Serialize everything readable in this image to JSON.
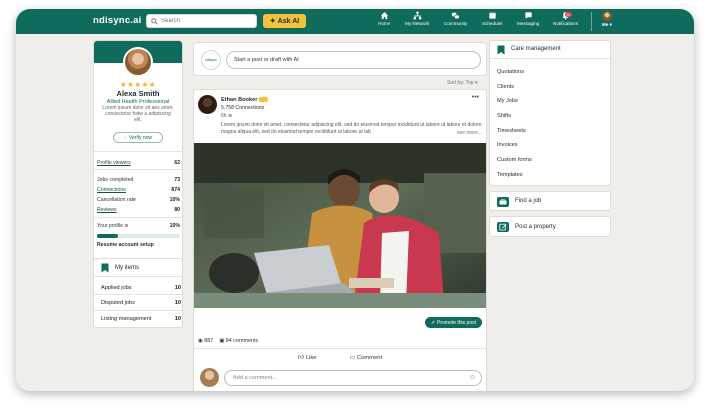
{
  "brand": {
    "logo": "ndisync.ai",
    "accent": "#0f6b5b",
    "gold": "#f3c13a"
  },
  "search": {
    "placeholder": "Search"
  },
  "ask_ai": {
    "label": "Ask AI"
  },
  "nav": [
    {
      "label": "Home",
      "icon": "home-icon"
    },
    {
      "label": "My Network",
      "icon": "network-icon"
    },
    {
      "label": "Community",
      "icon": "community-icon"
    },
    {
      "label": "Scheduler",
      "icon": "calendar-icon"
    },
    {
      "label": "Messaging",
      "icon": "message-icon"
    },
    {
      "label": "Notifications",
      "icon": "bell-icon",
      "badge": "20"
    },
    {
      "label": "Me ▾",
      "icon": "avatar"
    }
  ],
  "profile": {
    "stars": "★★★★★",
    "name": "Alexa Smith",
    "role": "Allied Health Professional",
    "bio": "Lorem ipsum dolor sit aes amet, consectetur fodw a adipiscing elit.",
    "verify_label": "Verify now",
    "stats": [
      {
        "label": "Profile viewers",
        "value": "62"
      },
      {
        "label": "Jobs completed",
        "value": "73"
      },
      {
        "label": "Connections",
        "value": "874"
      },
      {
        "label": "Cancellation rate",
        "value": "10%"
      },
      {
        "label": "Reviews",
        "value": "80"
      }
    ],
    "completion": {
      "label": "Your profile is",
      "value": "10%",
      "fraction": 0.25
    },
    "resume_label": "Resume account setup"
  },
  "my_items": {
    "title": "My items",
    "items": [
      {
        "label": "Applied jobs",
        "value": "10"
      },
      {
        "label": "Disputed jobs",
        "value": "10"
      },
      {
        "label": "Listing management",
        "value": "10"
      }
    ]
  },
  "composer": {
    "avatar_text": "ndisync",
    "placeholder": "Start a post or draft with AI"
  },
  "sort": {
    "label": "Sort by: Top ▾"
  },
  "post": {
    "author": "Ethan Booker",
    "connections": "5,758 Connections",
    "time": "5h",
    "text": "Lorem ipsum dolor sit amet, consectetur adipiscing elit, sed do eiusmod tempor incididunt ut labore ut labore et dolore magna aliqua elit, sed do eiusmod tempor incididunt ut labore ut lab",
    "see_more": "see more...",
    "promote_label": "Promote this post",
    "reactions": "887",
    "comments": "84 comments",
    "like_label": "Like",
    "comment_label": "Comment",
    "add_comment_placeholder": "Add a comment..."
  },
  "care_management": {
    "title": "Care management",
    "items": [
      "Quotations",
      "Clients",
      "My Jobs",
      "Shifts",
      "Timesheets",
      "Invoices",
      "Custom forms",
      "Templates"
    ]
  },
  "find_job": {
    "label": "Find a job"
  },
  "post_property": {
    "label": "Post a property"
  }
}
